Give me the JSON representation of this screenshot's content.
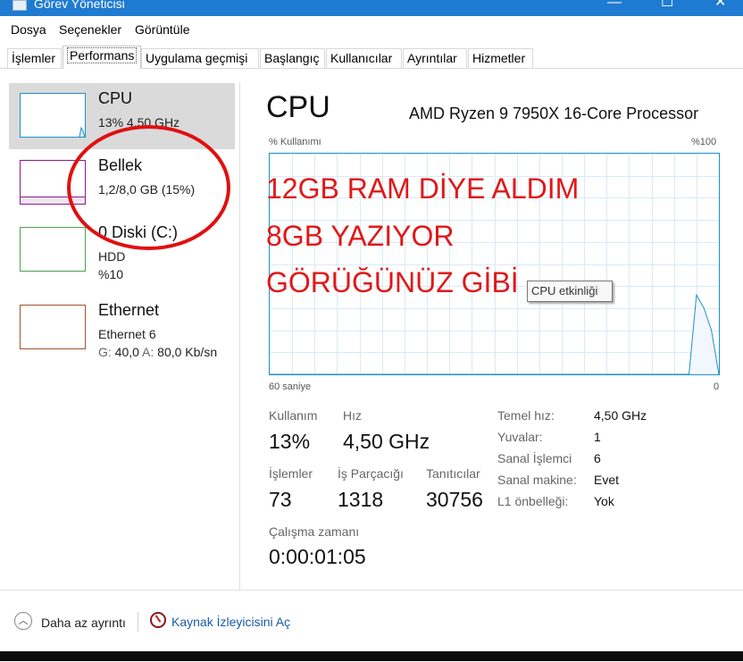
{
  "window": {
    "title": "Görev Yöneticisi",
    "controls": {
      "minimize": "—",
      "maximize": "☐",
      "close": "✕"
    }
  },
  "menu": [
    "Dosya",
    "Seçenekler",
    "Görüntüle"
  ],
  "tabs": [
    "İşlemler",
    "Performans",
    "Uygulama geçmişi",
    "Başlangıç",
    "Kullanıcılar",
    "Ayrıntılar",
    "Hizmetler"
  ],
  "sidebar": {
    "cpu": {
      "name": "CPU",
      "detail": "13%  4,50 GHz",
      "color": "#1a91c6"
    },
    "memory": {
      "name": "Bellek",
      "detail": "1,2/8,0 GB (15%)",
      "color": "#8b1a8f"
    },
    "disk": {
      "name": "0 Diski (C:)",
      "type": "HDD",
      "usage": "%10",
      "color": "#4da04d"
    },
    "ethernet": {
      "name": "Ethernet",
      "adapter": "Ethernet 6",
      "g_label": "G:",
      "g_value": "40,0",
      "a_label": "A:",
      "a_value": "80,0 Kb/sn",
      "color": "#a0522d"
    }
  },
  "main": {
    "title": "CPU",
    "processor": "AMD Ryzen 9 7950X 16-Core Processor",
    "graph": {
      "usage_label": "% Kullanımı",
      "max_label": "%100",
      "time_label": "60 saniye",
      "zero_label": "0",
      "tooltip": "CPU etkinliği"
    },
    "annotation": [
      "12GB RAM DİYE ALDIM",
      "8GB YAZIYOR",
      "GÖRÜĞÜNÜZ GİBİ"
    ],
    "stats": {
      "usage_label": "Kullanım",
      "usage_value": "13%",
      "speed_label": "Hız",
      "speed_value": "4,50 GHz",
      "processes_label": "İşlemler",
      "processes_value": "73",
      "threads_label": "İş Parçacığı",
      "threads_value": "1318",
      "handles_label": "Tanıtıcılar",
      "handles_value": "30756",
      "uptime_label": "Çalışma zamanı",
      "uptime_value": "0:00:01:05"
    },
    "specs": [
      {
        "label": "Temel hız:",
        "value": "4,50 GHz"
      },
      {
        "label": "Yuvalar:",
        "value": "1"
      },
      {
        "label": "Sanal İşlemci",
        "value": "6"
      },
      {
        "label": "Sanal makine:",
        "value": "Evet"
      },
      {
        "label": "L1 önbelleği:",
        "value": "Yok"
      }
    ]
  },
  "footer": {
    "fewer_details": "Daha az ayrıntı",
    "resource_monitor": "Kaynak İzleyicisini Aç"
  },
  "cpu_history_percent": [
    0,
    0,
    0,
    0,
    0,
    0,
    0,
    0,
    0,
    0,
    0,
    0,
    0,
    0,
    0,
    0,
    0,
    0,
    0,
    0,
    0,
    0,
    0,
    0,
    0,
    0,
    0,
    0,
    0,
    0,
    0,
    0,
    0,
    0,
    0,
    0,
    0,
    0,
    0,
    0,
    0,
    0,
    0,
    0,
    0,
    0,
    0,
    0,
    0,
    0,
    0,
    0,
    0,
    0,
    0,
    0,
    0,
    36,
    30,
    20,
    0
  ]
}
